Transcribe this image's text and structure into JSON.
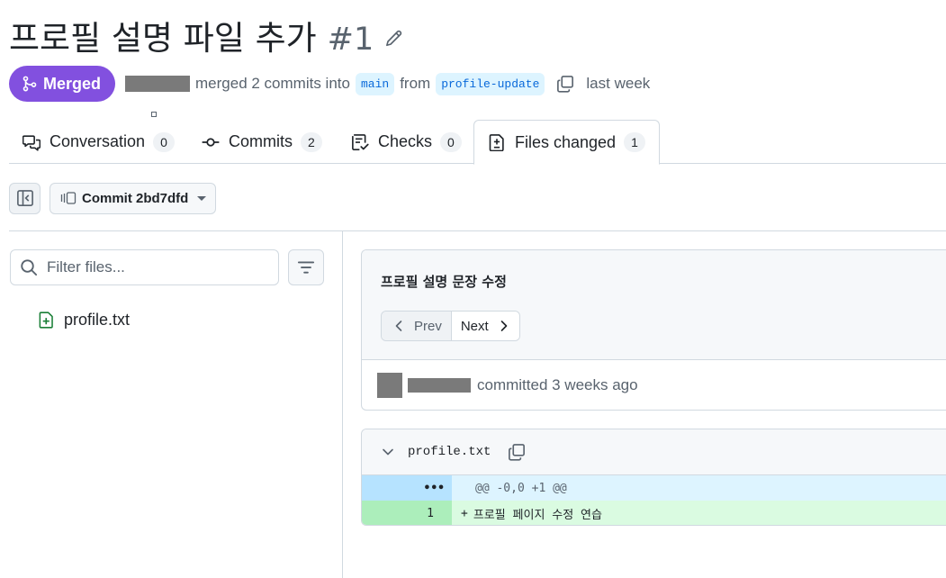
{
  "pr": {
    "title": "프로필 설명 파일 추가",
    "number": "#1",
    "state": "Merged",
    "merged_text": "merged 2 commits into",
    "base_branch": "main",
    "from_text": "from",
    "head_branch": "profile-update",
    "time": "last week"
  },
  "tabs": [
    {
      "label": "Conversation",
      "count": "0",
      "icon": "comment-discussion-icon"
    },
    {
      "label": "Commits",
      "count": "2",
      "icon": "git-commit-icon"
    },
    {
      "label": "Checks",
      "count": "0",
      "icon": "checklist-icon"
    },
    {
      "label": "Files changed",
      "count": "1",
      "icon": "file-diff-icon",
      "active": true
    }
  ],
  "toolbar": {
    "commit_select": "Commit 2bd7dfd"
  },
  "sidebar": {
    "filter_placeholder": "Filter files...",
    "files": [
      {
        "name": "profile.txt",
        "status": "added"
      }
    ]
  },
  "commit": {
    "message": "프로필 설명 문장 수정",
    "prev_label": "Prev",
    "next_label": "Next",
    "committed_text": "committed 3 weeks ago"
  },
  "diff": {
    "filename": "profile.txt",
    "hunk_marker": "•••",
    "hunk_header": "@@ -0,0 +1 @@",
    "lines": [
      {
        "number": "1",
        "sign": "+",
        "text": "프로필 페이지 수정 연습"
      }
    ]
  },
  "colors": {
    "merged_badge": "#8250df",
    "branch_bg": "#ddf4ff",
    "branch_fg": "#0969da",
    "add_line_bg": "#dafbe1",
    "add_num_bg": "#aceebb",
    "hunk_bg": "#ddf4ff"
  }
}
